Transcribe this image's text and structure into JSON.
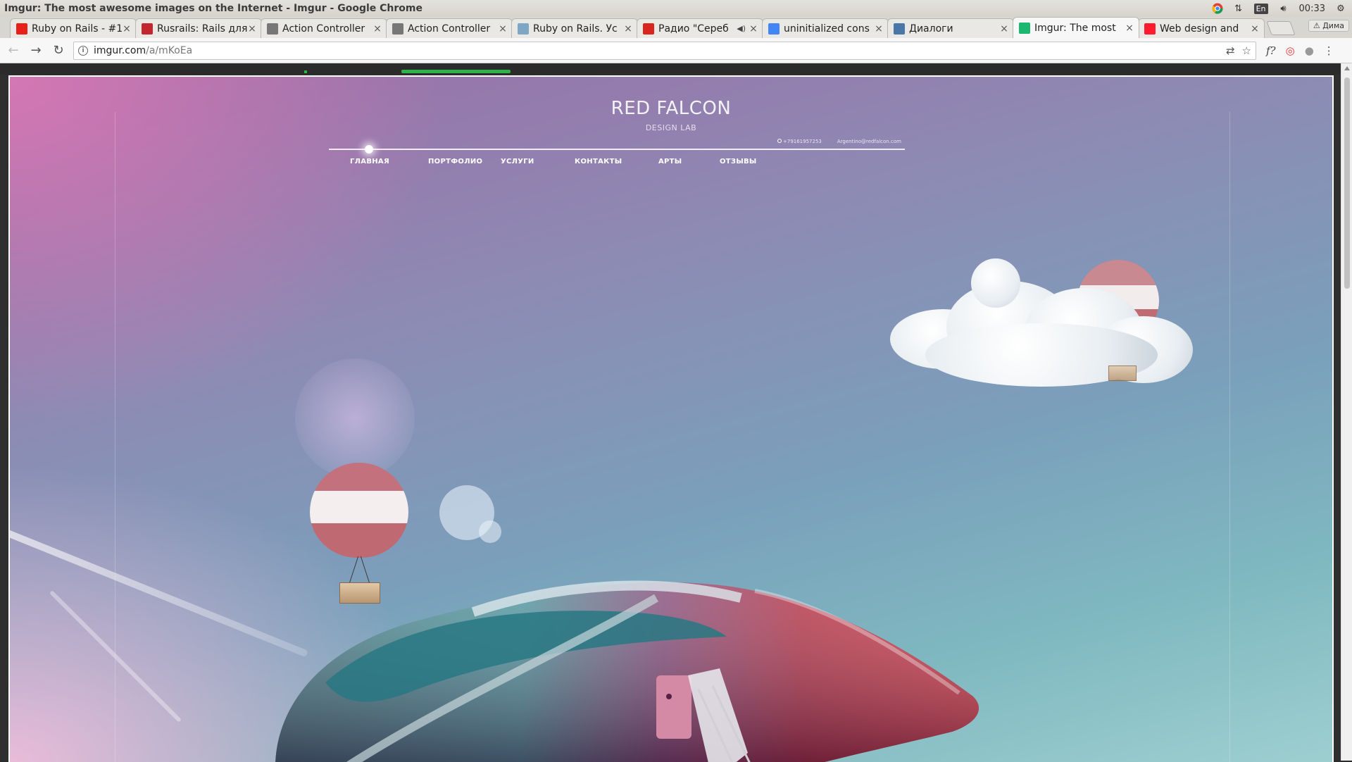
{
  "window": {
    "title": "Imgur: The most awesome images on the Internet - Imgur - Google Chrome",
    "tray": {
      "lang": "En",
      "time": "00:33"
    }
  },
  "tabs": [
    {
      "label": "Ruby on Rails - #1",
      "favicon": "youtube-icon",
      "color": "#e62117",
      "active": false
    },
    {
      "label": "Rusrails: Rails для",
      "favicon": "rusrails-icon",
      "color": "#c3262f",
      "active": false
    },
    {
      "label": "Action Controller",
      "favicon": "page-icon",
      "color": "#777777",
      "active": false
    },
    {
      "label": "Action Controller",
      "favicon": "page-icon",
      "color": "#777777",
      "active": false
    },
    {
      "label": "Ruby on Rails. Ус",
      "favicon": "habr-icon",
      "color": "#7ea7c6",
      "active": false
    },
    {
      "label": "Радио \"Сереб",
      "favicon": "radio-icon",
      "color": "#d9261c",
      "active": false,
      "audio": true
    },
    {
      "label": "uninitialized cons",
      "favicon": "google-icon",
      "color": "#4285f4",
      "active": false
    },
    {
      "label": "Диалоги",
      "favicon": "vk-icon",
      "color": "#4a76a8",
      "active": false
    },
    {
      "label": "Imgur: The most",
      "favicon": "imgur-icon",
      "color": "#1bb76e",
      "active": true
    },
    {
      "label": "Web design and",
      "favicon": "opera-icon",
      "color": "#ff1b2d",
      "active": false
    }
  ],
  "profile": "Дима",
  "address": {
    "host": "imgur.com",
    "path": "/a/mKoEa"
  },
  "mockup": {
    "brand": "RED FALCON",
    "subtitle": "DESIGN LAB",
    "phone": "+79161957253",
    "email": "Argentino@redfalcon.com",
    "menu": [
      "ГЛАВНАЯ",
      "ПОРТФОЛИО",
      "УСЛУГИ",
      "КОНТАКТЫ",
      "АРТЫ",
      "ОТЗЫВЫ"
    ],
    "active_menu": "ГЛАВНАЯ"
  },
  "colors": {
    "imgur_green": "#2db34a",
    "vehicle_red": "#c8202a",
    "vehicle_teal": "#3d8e96",
    "balloon_pink": "#c4737a"
  }
}
